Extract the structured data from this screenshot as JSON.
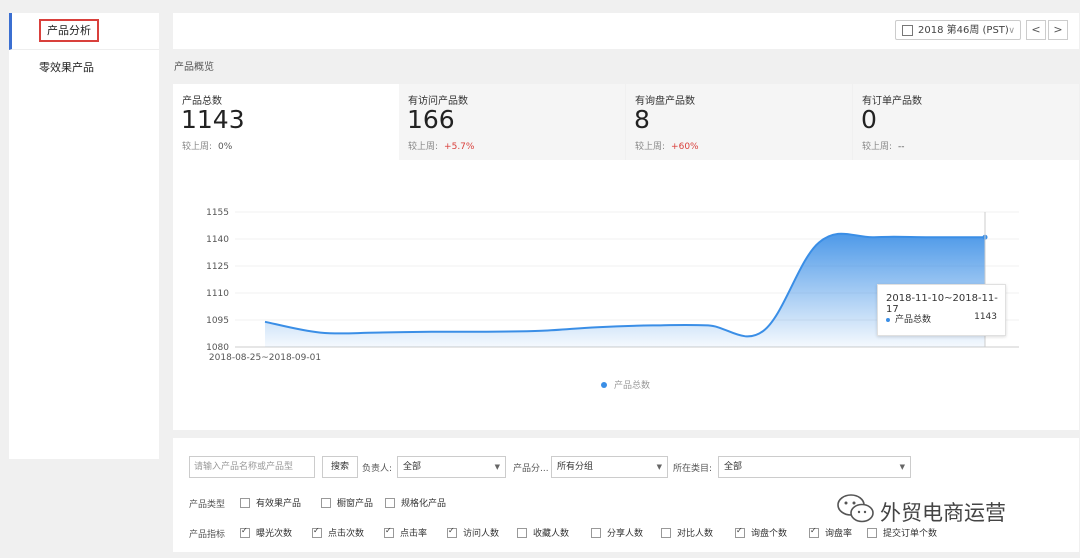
{
  "sidebar": {
    "items": [
      {
        "label": "产品分析"
      },
      {
        "label": "零效果产品"
      }
    ]
  },
  "topbar": {
    "week": "2018 第46周 (PST)",
    "prev": "<",
    "next": ">"
  },
  "section_title": "产品概览",
  "stats": [
    {
      "title": "产品总数",
      "value": "1143",
      "compare_label": "较上周:",
      "change": "0%"
    },
    {
      "title": "有访问产品数",
      "value": "166",
      "compare_label": "较上周:",
      "change": "+5.7%"
    },
    {
      "title": "有询盘产品数",
      "value": "8",
      "compare_label": "较上周:",
      "change": "+60%"
    },
    {
      "title": "有订单产品数",
      "value": "0",
      "compare_label": "较上周:",
      "change": "--"
    }
  ],
  "chart_data": {
    "type": "area",
    "yticks": [
      "1155",
      "1140",
      "1125",
      "1110",
      "1095",
      "1080"
    ],
    "ylim": [
      1080,
      1155
    ],
    "xlabel_first": "2018-08-25~2018-09-01",
    "series": [
      {
        "name": "产品总数",
        "values": [
          1094,
          1088,
          1088,
          1088.5,
          1088.5,
          1089,
          1091,
          1092,
          1092,
          1089,
          1138,
          1141,
          1141,
          1141
        ]
      }
    ],
    "legend": "bottom-center",
    "color": "#3a8ee6"
  },
  "tooltip": {
    "range": "2018-11-10~2018-11-17",
    "series": "产品总数",
    "value": "1143"
  },
  "filters": {
    "search_placeholder": "请输入产品名称或产品型",
    "search_button": "搜索",
    "owner_label": "负责人:",
    "owner_value": "全部",
    "group_label": "产品分...",
    "group_value": "所有分组",
    "category_label": "所在类目:",
    "category_value": "全部",
    "type_label": "产品类型",
    "types": [
      {
        "label": "有效果产品",
        "checked": false
      },
      {
        "label": "橱窗产品",
        "checked": false
      },
      {
        "label": "规格化产品",
        "checked": false
      }
    ],
    "metric_label": "产品指标",
    "metrics": [
      {
        "label": "曝光次数",
        "checked": true
      },
      {
        "label": "点击次数",
        "checked": true
      },
      {
        "label": "点击率",
        "checked": true
      },
      {
        "label": "访问人数",
        "checked": true
      },
      {
        "label": "收藏人数",
        "checked": false
      },
      {
        "label": "分享人数",
        "checked": false
      },
      {
        "label": "对比人数",
        "checked": false
      },
      {
        "label": "询盘个数",
        "checked": true
      },
      {
        "label": "询盘率",
        "checked": true
      },
      {
        "label": "提交订单个数",
        "checked": false
      }
    ]
  },
  "watermark": "外贸电商运营"
}
